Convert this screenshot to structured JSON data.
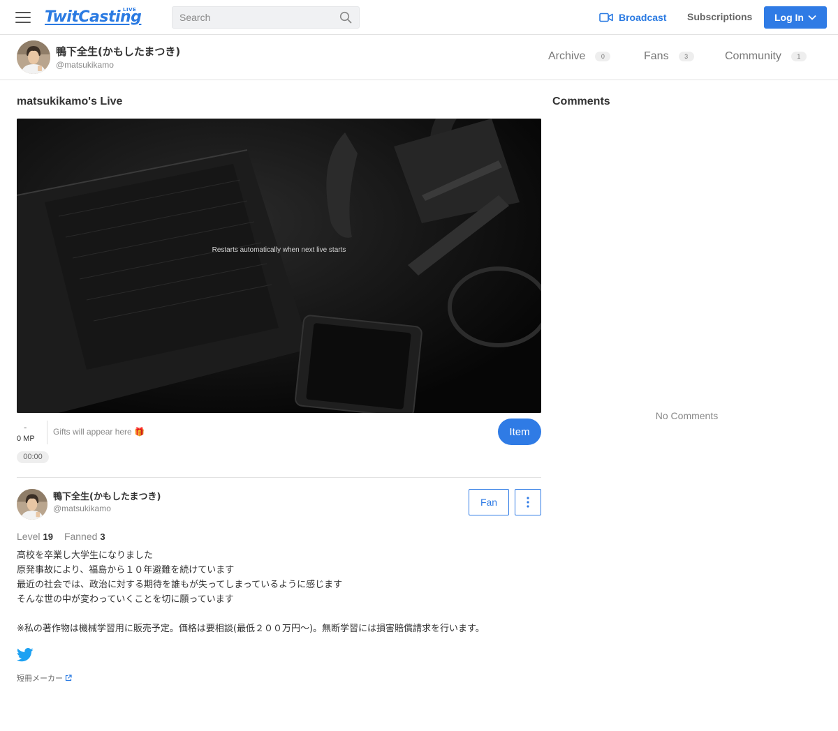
{
  "header": {
    "logo_text": "TwitCasting",
    "logo_badge": "LIVE",
    "search_placeholder": "Search",
    "broadcast_label": "Broadcast",
    "subscriptions_label": "Subscriptions",
    "login_label": "Log In",
    "accent_color": "#2f7be5"
  },
  "profile": {
    "name": "鴨下全生(かもしたまつき)",
    "handle": "@matsukikamo",
    "tabs": [
      {
        "label": "Archive",
        "count": "0"
      },
      {
        "label": "Fans",
        "count": "3"
      },
      {
        "label": "Community",
        "count": "1"
      }
    ]
  },
  "live": {
    "title": "matsukikamo's Live",
    "player_message": "Restarts automatically when next live starts",
    "mp_dash": "-",
    "mp_value": "0 MP",
    "gifts_text": "Gifts will appear here 🎁",
    "item_label": "Item",
    "timer": "00:00"
  },
  "owner": {
    "name": "鴨下全生(かもしたまつき)",
    "handle": "@matsukikamo",
    "fan_label": "Fan",
    "level_label": "Level",
    "level_value": "19",
    "fanned_label": "Fanned",
    "fanned_value": "3",
    "bio_lines": [
      "高校を卒業し大学生になりました",
      "原発事故により、福島から１０年避難を続けています",
      "最近の社会では、政治に対する期待を誰もが失ってしまっているように感じます",
      "そんな世の中が変わっていくことを切に願っています",
      "",
      "※私の著作物は機械学習用に販売予定。価格は要相談(最低２００万円〜)。無断学習には損害賠償請求を行います。"
    ],
    "external_link_label": "短冊メーカー"
  },
  "comments": {
    "title": "Comments",
    "empty_text": "No Comments"
  }
}
